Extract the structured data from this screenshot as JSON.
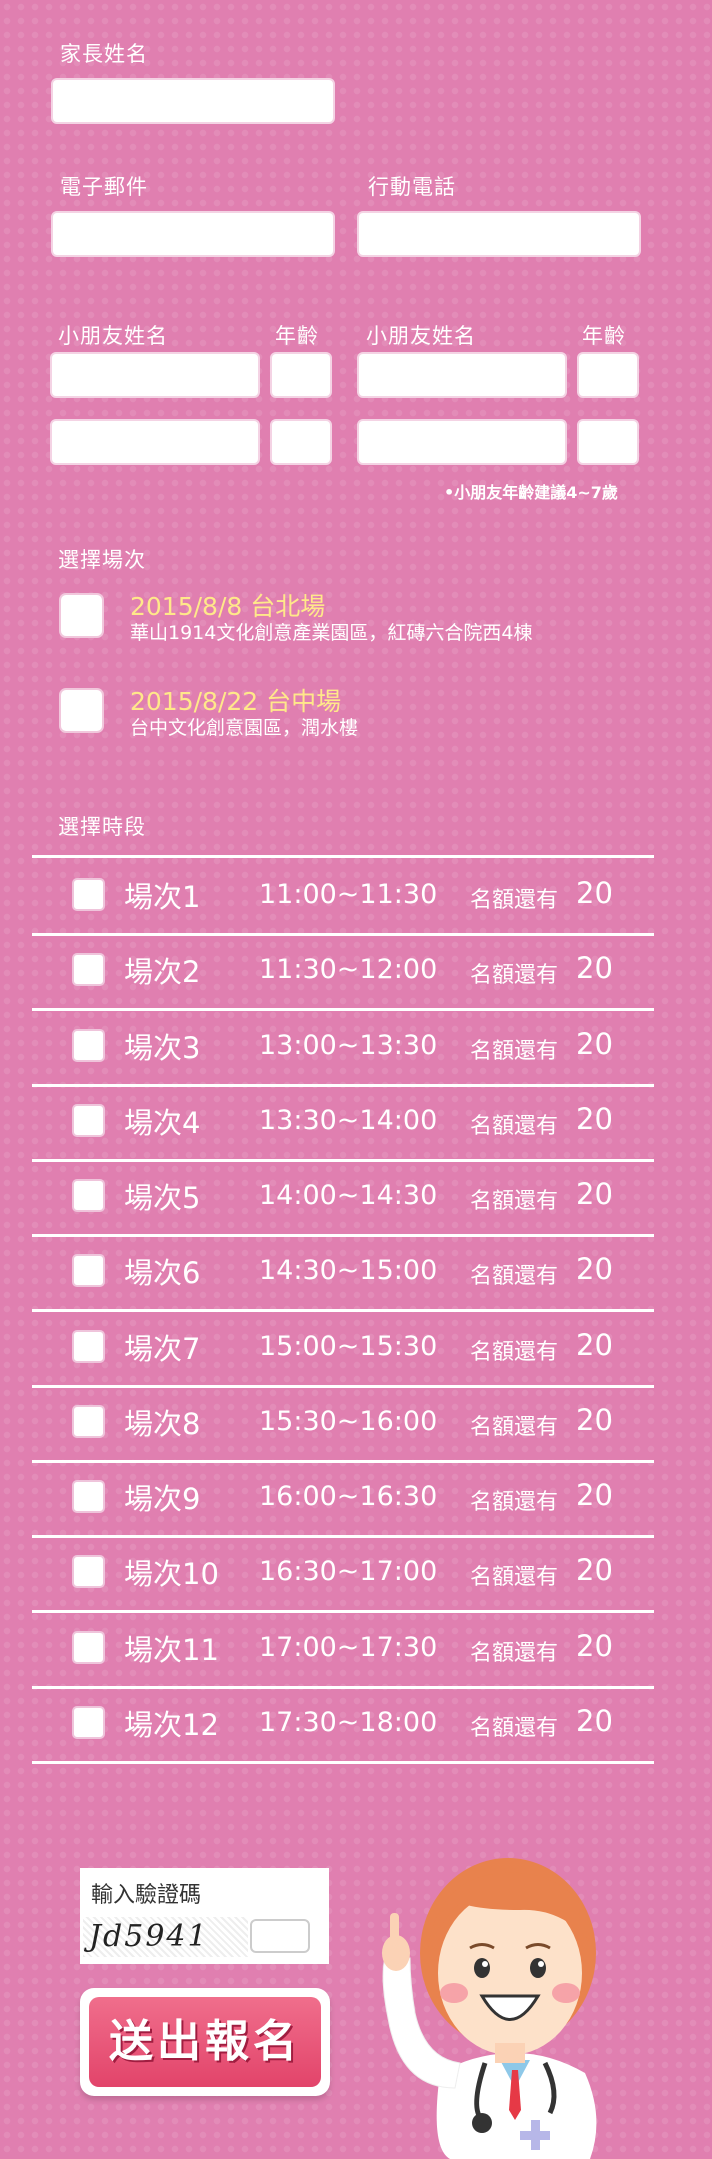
{
  "form": {
    "parent_name_label": "家長姓名",
    "email_label": "電子郵件",
    "phone_label": "行動電話",
    "child_name_label": "小朋友姓名",
    "age_label": "年齡",
    "age_hint": "小朋友年齡建議4~7歲"
  },
  "venue": {
    "title": "選擇場次",
    "options": [
      {
        "title": "2015/8/8 台北場",
        "location": "華山1914文化創意產業園區，紅磚六合院西4棟"
      },
      {
        "title": "2015/8/22 台中場",
        "location": "台中文化創意園區，潤水樓"
      }
    ]
  },
  "timeslots": {
    "title": "選擇時段",
    "quota_label": "名額還有",
    "items": [
      {
        "name": "場次1",
        "time": "11:00~11:30",
        "quota": "20"
      },
      {
        "name": "場次2",
        "time": "11:30~12:00",
        "quota": "20"
      },
      {
        "name": "場次3",
        "time": "13:00~13:30",
        "quota": "20"
      },
      {
        "name": "場次4",
        "time": "13:30~14:00",
        "quota": "20"
      },
      {
        "name": "場次5",
        "time": "14:00~14:30",
        "quota": "20"
      },
      {
        "name": "場次6",
        "time": "14:30~15:00",
        "quota": "20"
      },
      {
        "name": "場次7",
        "time": "15:00~15:30",
        "quota": "20"
      },
      {
        "name": "場次8",
        "time": "15:30~16:00",
        "quota": "20"
      },
      {
        "name": "場次9",
        "time": "16:00~16:30",
        "quota": "20"
      },
      {
        "name": "場次10",
        "time": "16:30~17:00",
        "quota": "20"
      },
      {
        "name": "場次11",
        "time": "17:00~17:30",
        "quota": "20"
      },
      {
        "name": "場次12",
        "time": "17:30~18:00",
        "quota": "20"
      }
    ]
  },
  "captcha": {
    "label": "輸入驗證碼",
    "code": "Jd5941"
  },
  "submit_label": "送出報名",
  "colors": {
    "background": "#e07fb0",
    "venue_title": "#ffe88a",
    "submit": "#e2446a"
  }
}
